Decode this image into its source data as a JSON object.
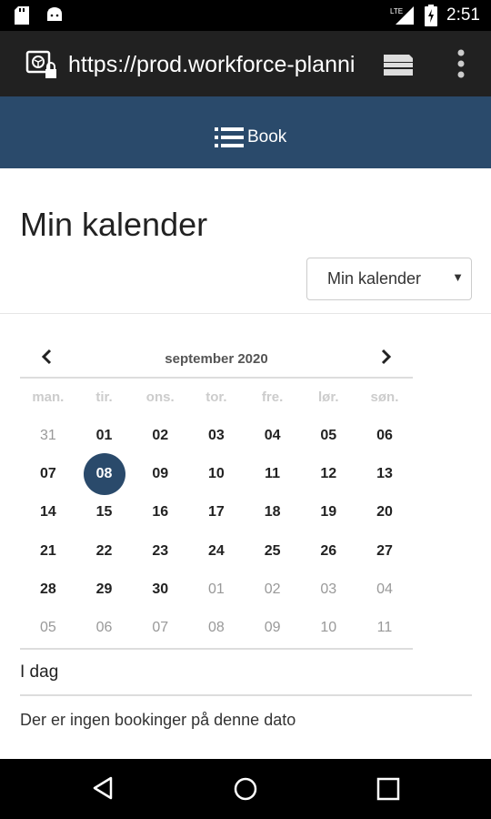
{
  "status_bar": {
    "time": "2:51",
    "network": "LTE",
    "icons": [
      "sd-card-icon",
      "android-icon",
      "signal-icon",
      "battery-icon"
    ]
  },
  "browser": {
    "url": "https://prod.workforce-planni",
    "icons": [
      "site-info-icon",
      "tabs-icon",
      "overflow-menu-icon"
    ]
  },
  "header": {
    "book_label": "Book",
    "background": "#2a4a6b"
  },
  "page": {
    "title": "Min kalender",
    "select_value": "Min kalender"
  },
  "calendar": {
    "month_label": "september 2020",
    "weekdays": [
      "man.",
      "tir.",
      "ons.",
      "tor.",
      "fre.",
      "lør.",
      "søn."
    ],
    "weeks": [
      [
        {
          "d": "31",
          "o": true
        },
        {
          "d": "01"
        },
        {
          "d": "02"
        },
        {
          "d": "03"
        },
        {
          "d": "04"
        },
        {
          "d": "05"
        },
        {
          "d": "06"
        }
      ],
      [
        {
          "d": "07"
        },
        {
          "d": "08",
          "sel": true
        },
        {
          "d": "09"
        },
        {
          "d": "10"
        },
        {
          "d": "11"
        },
        {
          "d": "12"
        },
        {
          "d": "13"
        }
      ],
      [
        {
          "d": "14"
        },
        {
          "d": "15"
        },
        {
          "d": "16"
        },
        {
          "d": "17"
        },
        {
          "d": "18"
        },
        {
          "d": "19"
        },
        {
          "d": "20"
        }
      ],
      [
        {
          "d": "21"
        },
        {
          "d": "22"
        },
        {
          "d": "23"
        },
        {
          "d": "24"
        },
        {
          "d": "25"
        },
        {
          "d": "26"
        },
        {
          "d": "27"
        }
      ],
      [
        {
          "d": "28"
        },
        {
          "d": "29"
        },
        {
          "d": "30"
        },
        {
          "d": "01",
          "o": true
        },
        {
          "d": "02",
          "o": true
        },
        {
          "d": "03",
          "o": true
        },
        {
          "d": "04",
          "o": true
        }
      ],
      [
        {
          "d": "05",
          "o": true
        },
        {
          "d": "06",
          "o": true
        },
        {
          "d": "07",
          "o": true
        },
        {
          "d": "08",
          "o": true
        },
        {
          "d": "09",
          "o": true
        },
        {
          "d": "10",
          "o": true
        },
        {
          "d": "11",
          "o": true
        }
      ]
    ],
    "selected_color": "#2a4a6b"
  },
  "today_label": "I dag",
  "no_bookings_text": "Der er ingen bookinger på denne dato"
}
